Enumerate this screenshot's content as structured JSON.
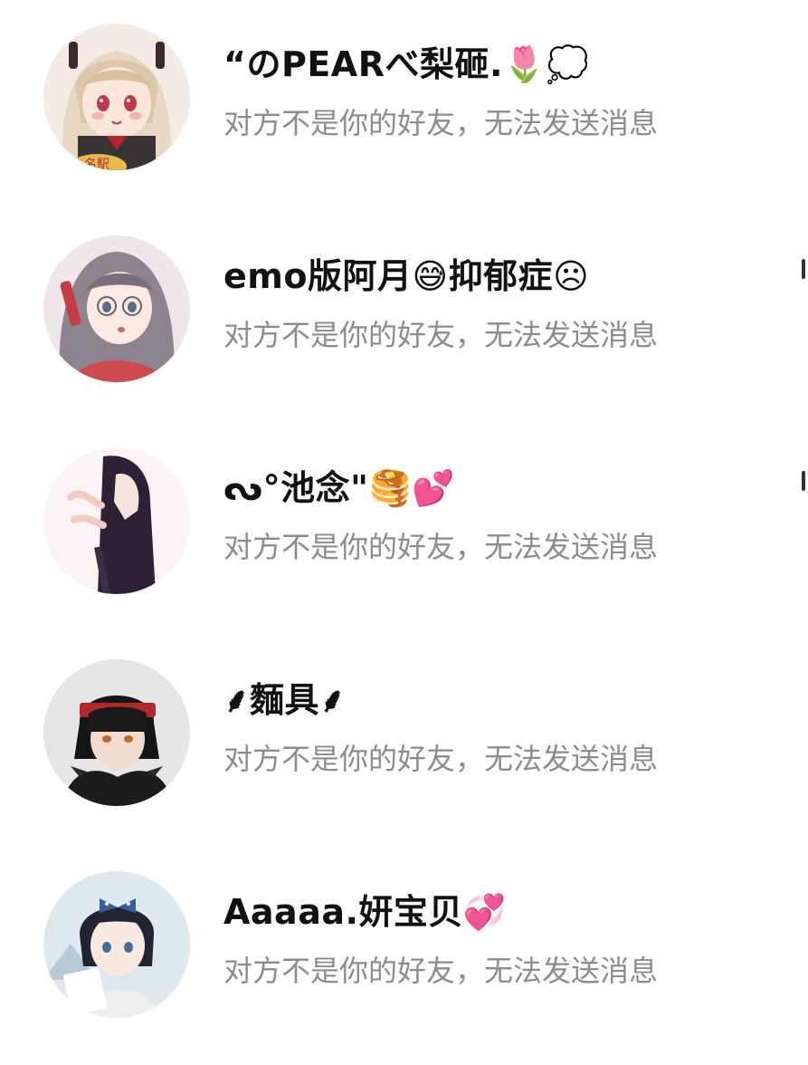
{
  "contacts": [
    {
      "name": "“のPEARべ梨砸.🌷💭",
      "message": "对方不是你的好友，无法发送消息",
      "avatar_icon": "anime-girl-blonde-avatar-icon"
    },
    {
      "name": "emo版阿月😅抑郁症☹",
      "message": "对方不是你的好友，无法发送消息",
      "avatar_icon": "anime-girl-gray-hair-glasses-avatar-icon"
    },
    {
      "name": "ᔓ°池念\"🥞💕",
      "message": "对方不是你的好友，无法发送消息",
      "avatar_icon": "anime-girl-dark-hair-avatar-icon"
    },
    {
      "name": "⸙麵具⸙",
      "message": "对方不是你的好友，无法发送消息",
      "avatar_icon": "anime-boy-headband-avatar-icon"
    },
    {
      "name": "Aaaaa.妍宝贝💞",
      "message": "对方不是你的好友，无法发送消息",
      "avatar_icon": "anime-girl-bow-avatar-icon"
    }
  ],
  "colors": {
    "name_text": "#111111",
    "message_text": "#8c8c8c",
    "background": "#ffffff"
  }
}
